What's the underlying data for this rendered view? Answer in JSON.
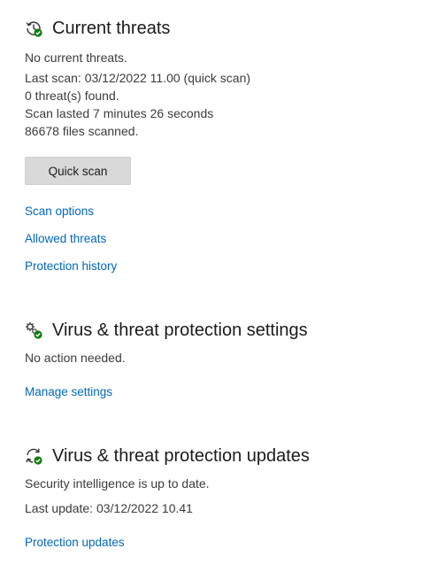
{
  "current_threats": {
    "icon": "history-shield-check-icon",
    "title": "Current threats",
    "status": "No current threats.",
    "last_scan": "Last scan: 03/12/2022 11.00 (quick scan)",
    "threats_found": "0 threat(s) found.",
    "scan_duration": "Scan lasted 7 minutes 26 seconds",
    "files_scanned": "86678 files scanned.",
    "quick_scan_label": "Quick scan",
    "links": {
      "scan_options": "Scan options",
      "allowed_threats": "Allowed threats",
      "protection_history": "Protection history"
    }
  },
  "settings": {
    "icon": "gears-check-icon",
    "title": "Virus & threat protection settings",
    "status": "No action needed.",
    "manage_link": "Manage settings"
  },
  "updates": {
    "icon": "refresh-check-icon",
    "title": "Virus & threat protection updates",
    "status": "Security intelligence is up to date.",
    "last_update": "Last update: 03/12/2022 10.41",
    "updates_link": "Protection updates"
  },
  "colors": {
    "link": "#0067c0",
    "check_badge": "#107c10",
    "button_bg": "#d9d9d9"
  }
}
